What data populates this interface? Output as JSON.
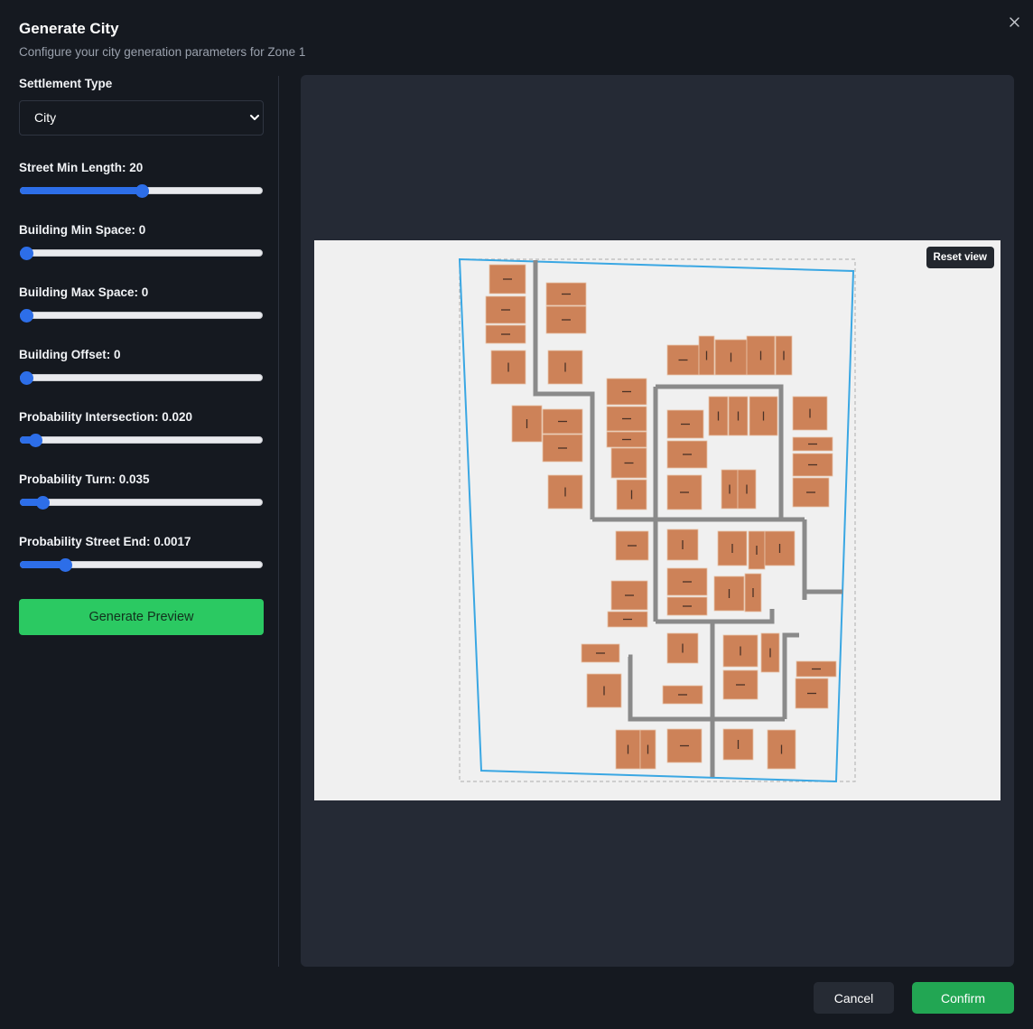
{
  "dialog": {
    "title": "Generate City",
    "subtitle": "Configure your city generation parameters for Zone 1"
  },
  "settlement": {
    "label": "Settlement Type",
    "selected": "City"
  },
  "sliders": [
    {
      "label": "Street Min Length: 20",
      "fraction": 0.5
    },
    {
      "label": "Building Min Space: 0",
      "fraction": 0.0
    },
    {
      "label": "Building Max Space: 0",
      "fraction": 0.0
    },
    {
      "label": "Building Offset: 0",
      "fraction": 0.0
    },
    {
      "label": "Probability Intersection: 0.020",
      "fraction": 0.04
    },
    {
      "label": "Probability Turn: 0.035",
      "fraction": 0.07
    },
    {
      "label": "Probability Street End: 0.0017",
      "fraction": 0.17
    }
  ],
  "generate_button": "Generate Preview",
  "preview": {
    "reset_label": "Reset view"
  },
  "footer": {
    "cancel": "Cancel",
    "confirm": "Confirm"
  },
  "colors": {
    "accent": "#2d6ee8",
    "generate": "#2bc962",
    "confirm": "#22a653",
    "building": "#cd8258",
    "street": "#8a8a8a",
    "zone_boundary": "#3aa7e3"
  },
  "icons": {
    "close": "close-icon",
    "select": "chevron-down-icon"
  }
}
